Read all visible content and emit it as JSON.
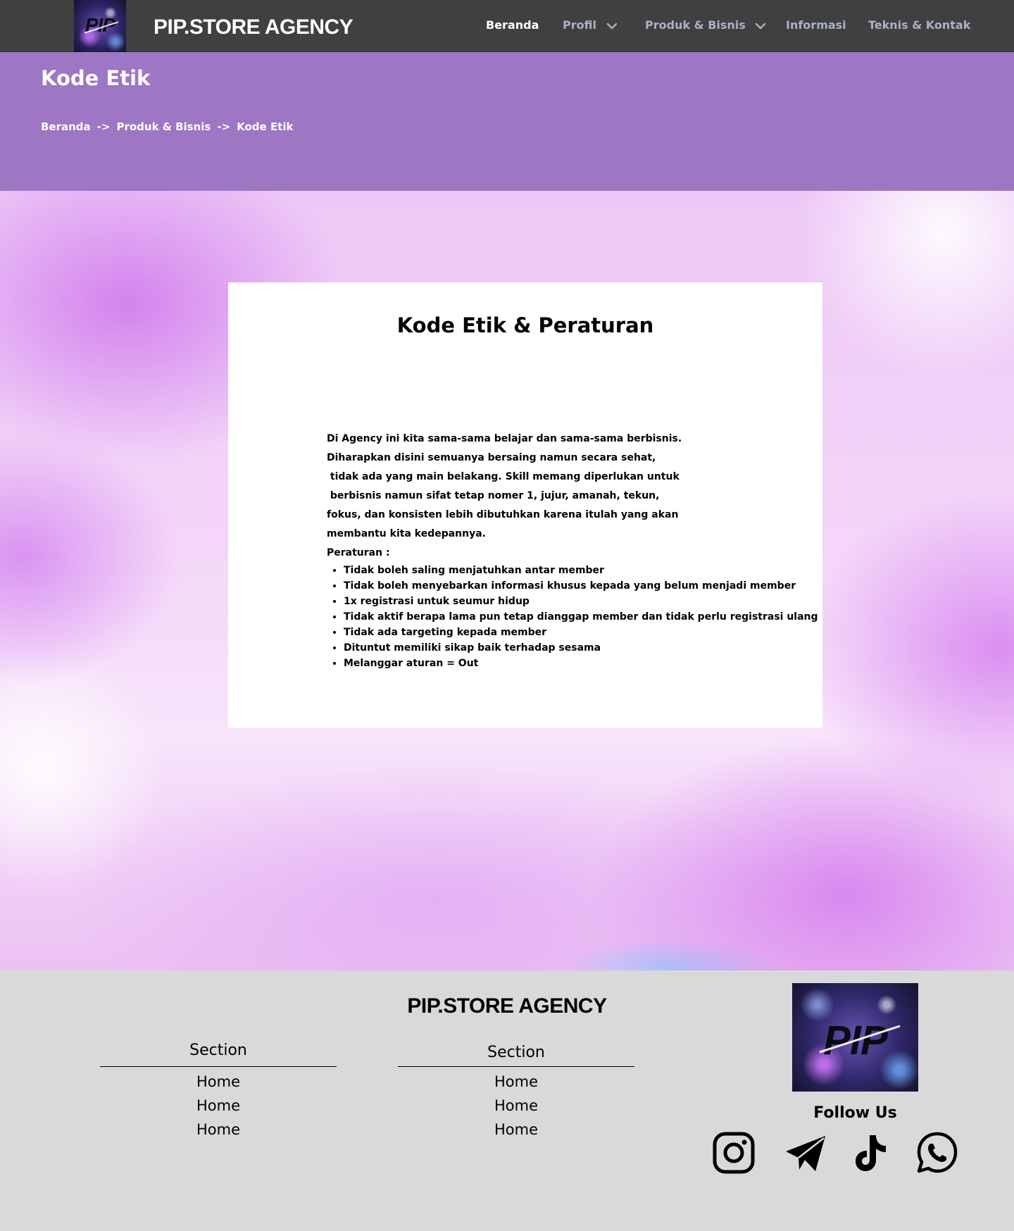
{
  "navbar": {
    "brand": "PIP.STORE AGENCY",
    "logo_text": "PIP",
    "items": [
      {
        "label": "Beranda"
      },
      {
        "label": "Profil"
      },
      {
        "label": "Produk & Bisnis"
      },
      {
        "label": "Informasi"
      },
      {
        "label": "Teknis & Kontak"
      }
    ]
  },
  "header": {
    "title": "Kode Etik",
    "breadcrumb": {
      "items": [
        "Beranda",
        "Produk & Bisnis",
        "Kode Etik"
      ],
      "separator": "->"
    }
  },
  "card": {
    "title": "Kode Etik & Peraturan",
    "intro_lines": [
      "Di Agency ini kita sama-sama belajar dan sama-sama berbisnis.",
      "Diharapkan disini semuanya bersaing namun secara sehat,",
      " tidak ada yang main belakang. Skill memang diperlukan untuk",
      " berbisnis namun sifat tetap nomer 1, jujur, amanah, tekun,",
      "fokus, dan konsisten lebih dibutuhkan karena itulah yang akan",
      "membantu kita kedepannya."
    ],
    "rules_heading": "Peraturan :",
    "rules": [
      "Tidak boleh saling menjatuhkan antar member",
      "Tidak boleh menyebarkan informasi khusus kepada yang belum menjadi member",
      "1x registrasi untuk seumur hidup",
      "Tidak aktif berapa lama pun tetap dianggap member dan tidak perlu registrasi ulang",
      "Tidak ada targeting kepada member",
      "Dituntut memiliki sikap baik terhadap sesama",
      "Melanggar aturan = Out"
    ]
  },
  "footer": {
    "brand": "PIP.STORE AGENCY",
    "logo_text": "PIP",
    "columns": [
      {
        "title": "Section",
        "links": [
          "Home",
          "Home",
          "Home"
        ]
      },
      {
        "title": "Section",
        "links": [
          "Home",
          "Home",
          "Home"
        ]
      }
    ],
    "follow_label": "Follow Us",
    "socials": [
      {
        "icon": "instagram-icon"
      },
      {
        "icon": "telegram-icon"
      },
      {
        "icon": "tiktok-icon"
      },
      {
        "icon": "whatsapp-icon"
      }
    ]
  },
  "colors": {
    "navbar_bg": "#404040",
    "header_bg": "#9d76c4",
    "footer_bg": "#d9d9d9",
    "nav_active": "#ffffff",
    "nav_inactive": "#a9b2c4"
  }
}
